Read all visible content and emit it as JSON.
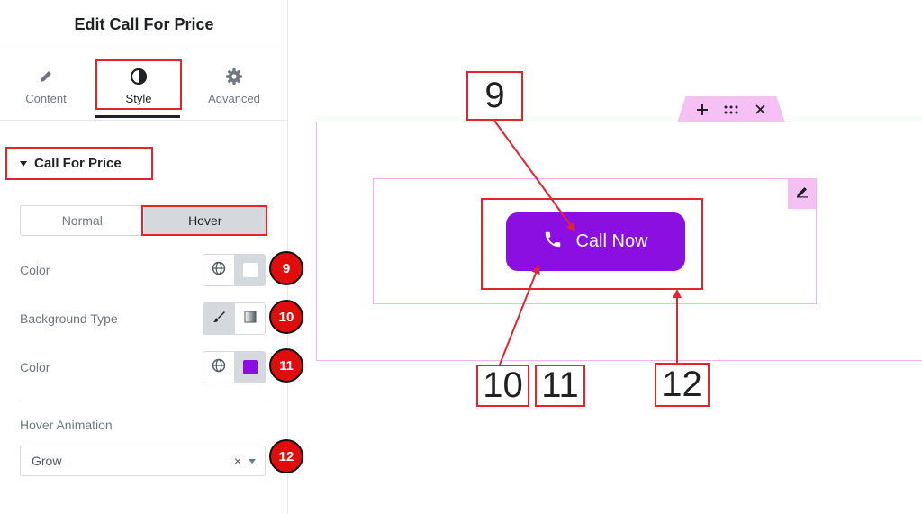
{
  "panel": {
    "title": "Edit Call For Price",
    "tabs": [
      {
        "label": "Content",
        "icon": "pencil-icon"
      },
      {
        "label": "Style",
        "icon": "contrast-icon",
        "active": true
      },
      {
        "label": "Advanced",
        "icon": "gear-icon"
      }
    ],
    "section": {
      "title": "Call For Price",
      "expanded": true
    },
    "state_tabs": {
      "normal": "Normal",
      "hover": "Hover",
      "active": "Hover"
    },
    "controls": {
      "color": {
        "label": "Color",
        "value": "#ffffff"
      },
      "background_type": {
        "label": "Background Type",
        "selected": "classic"
      },
      "bg_color": {
        "label": "Color",
        "value": "#8a0fe0"
      },
      "hover_animation": {
        "label": "Hover Animation",
        "value": "Grow",
        "clear": "×"
      }
    },
    "badges": [
      "9",
      "10",
      "11",
      "12"
    ]
  },
  "canvas": {
    "button": {
      "label": "Call Now",
      "icon": "phone-icon",
      "background": "#8a0fe0",
      "text_color": "#ffffff"
    },
    "callouts": [
      "9",
      "10",
      "11",
      "12"
    ]
  },
  "colors": {
    "accent_red": "#e2262a",
    "badge_red": "#e00d0d",
    "handle_pink": "#f5c1f5",
    "button_purple": "#8a0fe0"
  }
}
